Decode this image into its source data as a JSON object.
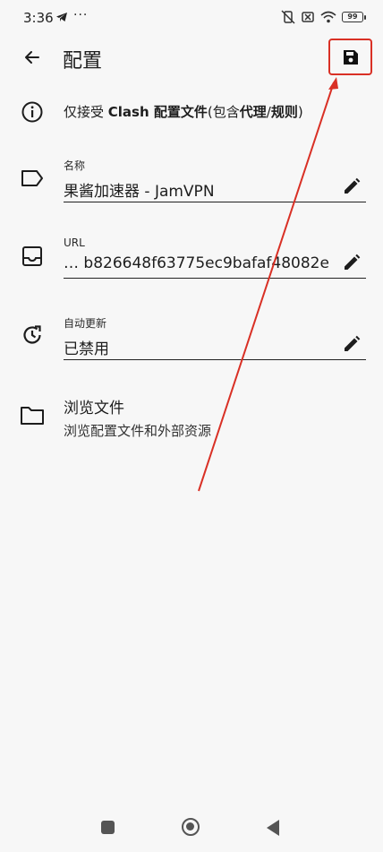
{
  "status_bar": {
    "time": "3:36",
    "dots": "···",
    "battery": "99"
  },
  "header": {
    "title": "配置"
  },
  "info": {
    "prefix": "仅接受 ",
    "bold1": "Clash 配置文件",
    "mid": "(包含",
    "bold2": "代理",
    "slash": "/",
    "bold3": "规则",
    "suffix": ")"
  },
  "fields": {
    "name": {
      "label": "名称",
      "value": "果酱加速器 - JamVPN"
    },
    "url": {
      "label": "URL",
      "value": "…      b826648f63775ec9bafaf48082e"
    },
    "auto_update": {
      "label": "自动更新",
      "value": "已禁用"
    }
  },
  "browse": {
    "title": "浏览文件",
    "subtitle": "浏览配置文件和外部资源"
  },
  "colors": {
    "annotation": "#d93025",
    "background": "#f7f7f7"
  }
}
